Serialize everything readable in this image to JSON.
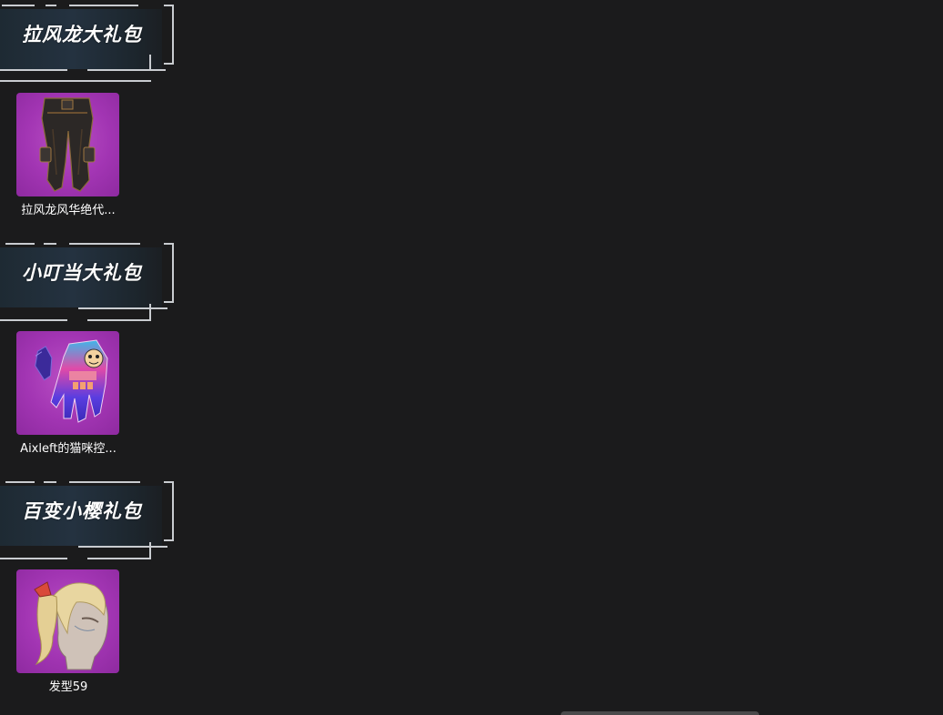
{
  "gift_sections": [
    {
      "title": "拉风龙大礼包",
      "item": {
        "name": "拉风龙风华绝代...",
        "icon": "pants-icon"
      }
    },
    {
      "title": "小叮当大礼包",
      "item": {
        "name": "Aixleft的猫咪控...",
        "icon": "gloves-icon"
      }
    },
    {
      "title": "百变小樱礼包",
      "item": {
        "name": "发型59",
        "icon": "hairstyle-icon"
      }
    }
  ],
  "colors": {
    "background": "#1b1b1c",
    "item_card": "#a235b3",
    "header_panel": "#243240",
    "frame_lines": "#c9ccd0",
    "text": "#ffffff"
  }
}
